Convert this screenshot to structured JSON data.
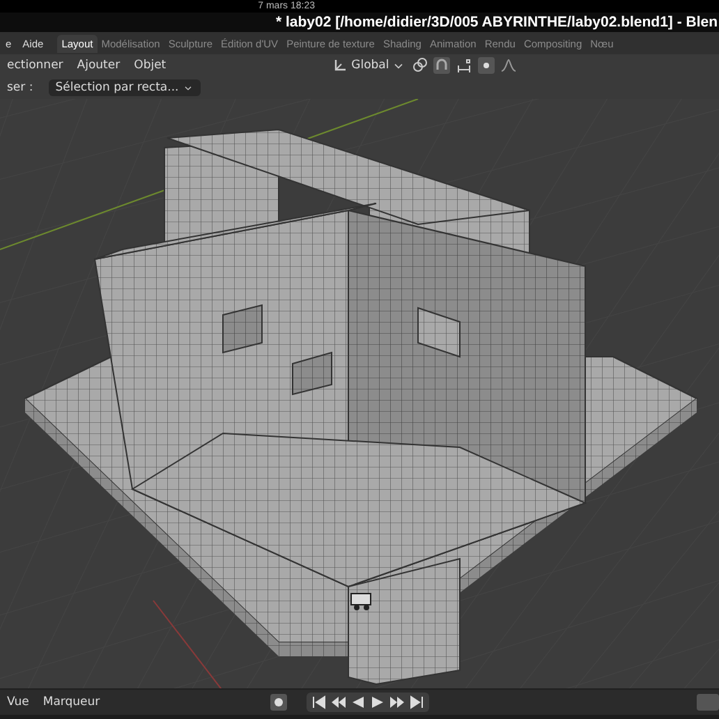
{
  "system_bar": {
    "clock": "7 mars  18:23"
  },
  "window": {
    "title": "* laby02 [/home/didier/3D/005 ABYRINTHE/laby02.blend1] - Blen"
  },
  "menu": [
    "e",
    "Aide"
  ],
  "workspaces": [
    {
      "label": "Layout",
      "selected": true
    },
    {
      "label": "Modélisation",
      "selected": false
    },
    {
      "label": "Sculpture",
      "selected": false
    },
    {
      "label": "Édition d'UV",
      "selected": false
    },
    {
      "label": "Peinture de texture",
      "selected": false
    },
    {
      "label": "Shading",
      "selected": false
    },
    {
      "label": "Animation",
      "selected": false
    },
    {
      "label": "Rendu",
      "selected": false
    },
    {
      "label": "Compositing",
      "selected": false
    },
    {
      "label": "Nœu",
      "selected": false
    }
  ],
  "viewport_header": {
    "menus": [
      "ectionner",
      "Ajouter",
      "Objet"
    ],
    "orientation": "Global"
  },
  "tool_settings": {
    "label": "ser :",
    "mode": "Sélection par recta..."
  },
  "timeline": {
    "menus": [
      "Vue",
      "Marqueur"
    ]
  }
}
